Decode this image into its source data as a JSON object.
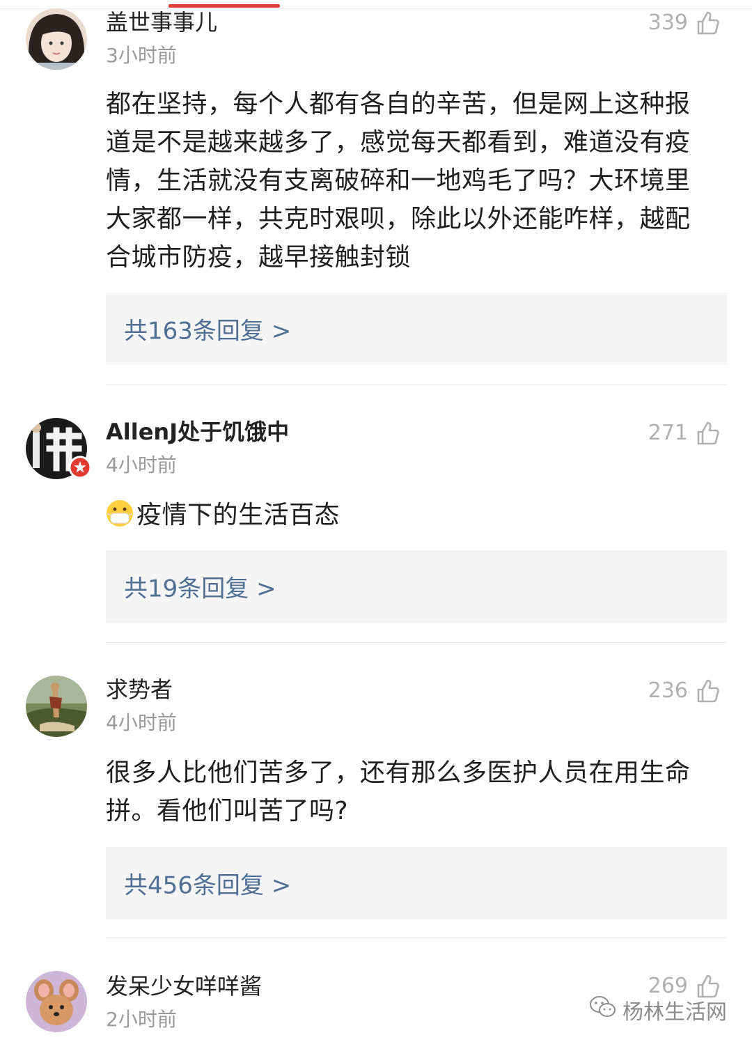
{
  "comments": [
    {
      "username": "盖世事事儿",
      "time": "3小时前",
      "likes": "339",
      "text": "都在坚持，每个人都有各自的辛苦，但是网上这种报道是不是越来越多了，感觉每天都看到，难道没有疫情，生活就没有支离破碎和一地鸡毛了吗？大环境里大家都一样，共克时艰呗，除此以外还能咋样，越配合城市防疫，越早接触封锁",
      "replies": "共163条回复 >"
    },
    {
      "username": "AllenJ处于饥饿中",
      "time": "4小时前",
      "likes": "271",
      "text": "疫情下的生活百态",
      "emoji": "mask-face-emoji",
      "replies": "共19条回复 >"
    },
    {
      "username": "求势者",
      "time": "4小时前",
      "likes": "236",
      "text": "很多人比他们苦多了，还有那么多医护人员在用生命拼。看他们叫苦了吗?",
      "replies": "共456条回复 >"
    },
    {
      "username": "发呆少女咩咩酱",
      "time": "2小时前",
      "likes": "269"
    }
  ],
  "watermark": "杨林生活网",
  "colors": {
    "accent": "#e0433b",
    "reply_link": "#506f94",
    "reply_bg": "#f5f5f5",
    "meta_gray": "#9a9a9a"
  },
  "icons": {
    "like": "thumbs-up-icon",
    "verified": "verified-badge-icon",
    "watermark": "wechat-icon"
  }
}
